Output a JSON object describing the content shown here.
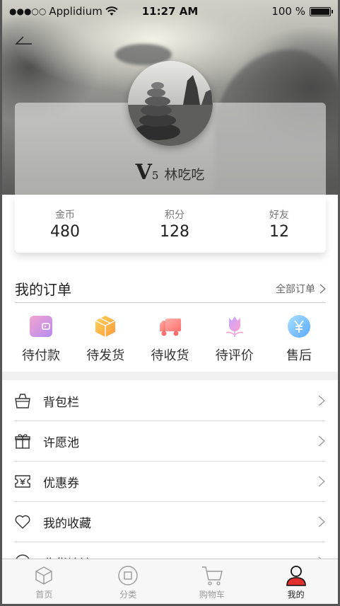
{
  "status_bar": {
    "signal_dots": "●●●○○",
    "carrier": "Applidium",
    "time": "11:27 AM",
    "battery_text": "100 %"
  },
  "profile": {
    "vip_letter": "V",
    "vip_level": "5",
    "username": "林吃吃"
  },
  "stats": [
    {
      "label": "金币",
      "value": "480"
    },
    {
      "label": "积分",
      "value": "128"
    },
    {
      "label": "好友",
      "value": "12"
    }
  ],
  "orders": {
    "title": "我的订单",
    "all_label": "全部订单",
    "items": [
      {
        "label": "待付款",
        "icon": "wallet-icon"
      },
      {
        "label": "待发货",
        "icon": "package-icon"
      },
      {
        "label": "待收货",
        "icon": "truck-icon"
      },
      {
        "label": "待评价",
        "icon": "flower-icon"
      },
      {
        "label": "售后",
        "icon": "yen-icon"
      }
    ]
  },
  "menu": [
    {
      "label": "背包栏",
      "icon": "bag-icon"
    },
    {
      "label": "许愿池",
      "icon": "gift-icon"
    },
    {
      "label": "优惠券",
      "icon": "coupon-icon"
    },
    {
      "label": "我的收藏",
      "icon": "heart-icon"
    },
    {
      "label": "收货地址",
      "icon": "location-icon"
    }
  ],
  "tabs": [
    {
      "label": "首页",
      "icon": "cube-icon",
      "active": false
    },
    {
      "label": "分类",
      "icon": "category-icon",
      "active": false
    },
    {
      "label": "购物车",
      "icon": "cart-icon",
      "active": false
    },
    {
      "label": "我的",
      "icon": "user-icon",
      "active": true
    }
  ],
  "colors": {
    "accent_red": "#e0312f",
    "wallet_gradient": [
      "#f3a3cf",
      "#b58cf0"
    ],
    "package_gradient": [
      "#ffd35a",
      "#ff9a3c"
    ],
    "truck_gradient": [
      "#ffb0a8",
      "#ff6f6f"
    ],
    "flower_gradient": [
      "#c4a6ff",
      "#ff9fd0"
    ],
    "yen_gradient": [
      "#a8e0ff",
      "#5aa8ff"
    ]
  }
}
